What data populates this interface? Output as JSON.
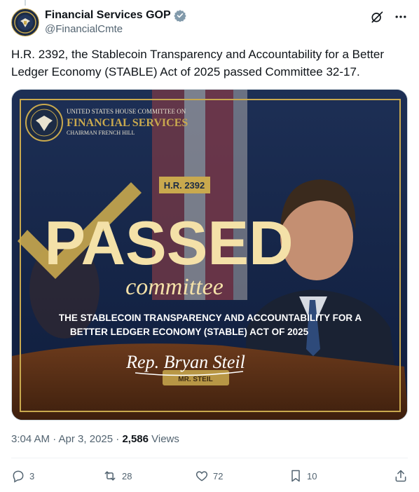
{
  "tweet": {
    "display_name": "Financial Services GOP",
    "handle": "@FinancialCmte",
    "text": "H.R. 2392, the Stablecoin Transparency and Accountability for a Better Ledger Economy (STABLE) Act of 2025 passed Committee 32-17.",
    "time": "3:04 AM · Apr 3, 2025 · ",
    "views_count": "2,586",
    "views_label": " Views"
  },
  "media": {
    "org_line1": "UNITED STATES HOUSE COMMITTEE ON",
    "org_line2": "FINANCIAL SERVICES",
    "org_line3": "CHAIRMAN FRENCH HILL",
    "bill_badge": "H.R. 2392",
    "headline": "PASSED",
    "subhead": "committee",
    "bill_title_line1": "THE STABLECOIN TRANSPARENCY AND ACCOUNTABILITY FOR A",
    "bill_title_line2": "BETTER LEDGER ECONOMY (STABLE) ACT OF 2025",
    "signature": "Rep. Bryan Steil",
    "nameplate": "MR. STEIL"
  },
  "actions": {
    "replies": "3",
    "reposts": "28",
    "likes": "72",
    "bookmarks": "10"
  },
  "colors": {
    "accent_gold": "#c9a94e",
    "navy": "#14254a",
    "verified_badge": "#829aab",
    "muted_text": "#536471"
  },
  "icons": [
    "verified-badge-icon",
    "grok-icon",
    "more-icon",
    "reply-icon",
    "repost-icon",
    "like-icon",
    "bookmark-icon",
    "share-icon",
    "seal-icon",
    "checkmark-icon"
  ]
}
